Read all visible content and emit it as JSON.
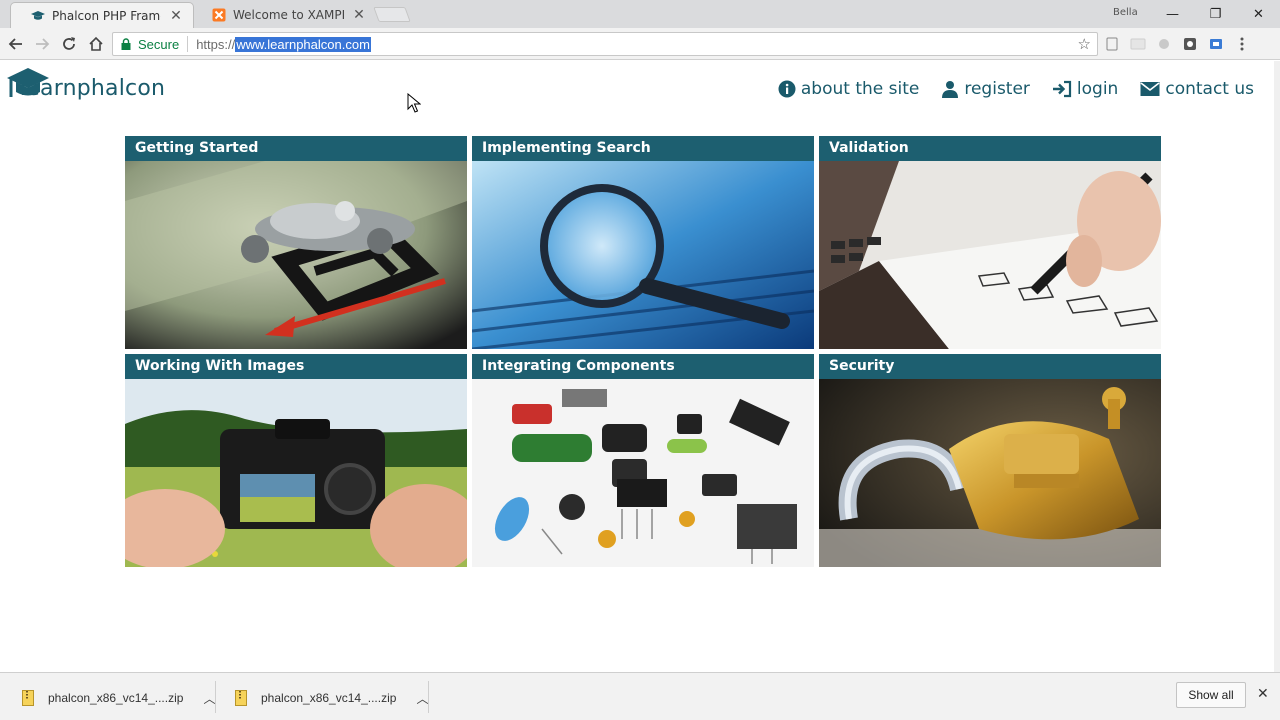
{
  "browser": {
    "tabs": [
      {
        "title": "Phalcon PHP Framework",
        "active": true
      },
      {
        "title": "Welcome to XAMPP",
        "active": false
      }
    ],
    "profile_label": "Bella",
    "window_controls": {
      "minimize": "—",
      "restore": "❐",
      "close": "✕"
    },
    "address": {
      "secure_label": "Secure",
      "scheme": "https://",
      "host": "www.learnphalcon.com"
    }
  },
  "site": {
    "logo_text": "learnphalcon",
    "nav": [
      {
        "label": "about the site",
        "icon": "info-icon"
      },
      {
        "label": "register",
        "icon": "user-icon"
      },
      {
        "label": "login",
        "icon": "login-icon"
      },
      {
        "label": "contact us",
        "icon": "mail-icon"
      }
    ],
    "cards": [
      {
        "title": "Getting Started",
        "image": "monopoly-car-image"
      },
      {
        "title": "Implementing Search",
        "image": "magnifying-glass-image"
      },
      {
        "title": "Validation",
        "image": "pen-checklist-image"
      },
      {
        "title": "Working With Images",
        "image": "camera-field-image"
      },
      {
        "title": "Integrating Components",
        "image": "electronic-components-image"
      },
      {
        "title": "Security",
        "image": "open-padlock-image"
      }
    ],
    "colors": {
      "brand": "#1d5f70",
      "link": "#1a5a6b"
    }
  },
  "downloads": {
    "items": [
      {
        "name": "phalcon_x86_vc14_....zip"
      },
      {
        "name": "phalcon_x86_vc14_....zip"
      }
    ],
    "show_all_label": "Show all"
  }
}
